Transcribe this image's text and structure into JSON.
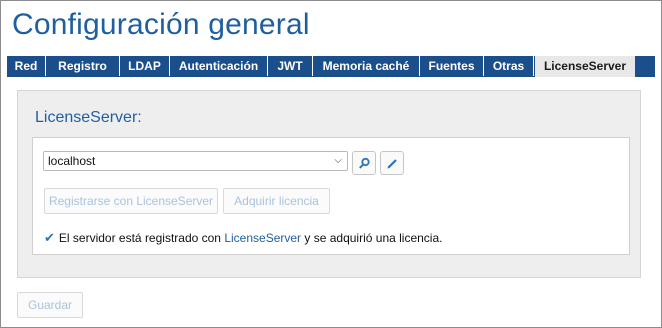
{
  "page": {
    "title": "Configuración general"
  },
  "tabs": [
    {
      "label": "Red"
    },
    {
      "label": "Registro"
    },
    {
      "label": "LDAP"
    },
    {
      "label": "Autenticación"
    },
    {
      "label": "JWT"
    },
    {
      "label": "Memoria caché"
    },
    {
      "label": "Fuentes"
    },
    {
      "label": "Otras"
    },
    {
      "label": "LicenseServer",
      "active": true
    }
  ],
  "licenseserver": {
    "section_label": "LicenseServer:",
    "server_select": {
      "value": "localhost"
    },
    "search_icon": "search-icon",
    "edit_icon": "pencil-icon",
    "register_button": "Registrarse con LicenseServer",
    "acquire_button": "Adquirir licencia",
    "status": {
      "prefix": "El servidor está registrado con",
      "link": "LicenseServer",
      "suffix": "y se adquirió una licencia."
    }
  },
  "footer": {
    "save_button": "Guardar"
  },
  "colors": {
    "brand_blue": "#1b4f8c",
    "title_blue": "#1f5f9f",
    "disabled_text": "#a9c3de"
  }
}
